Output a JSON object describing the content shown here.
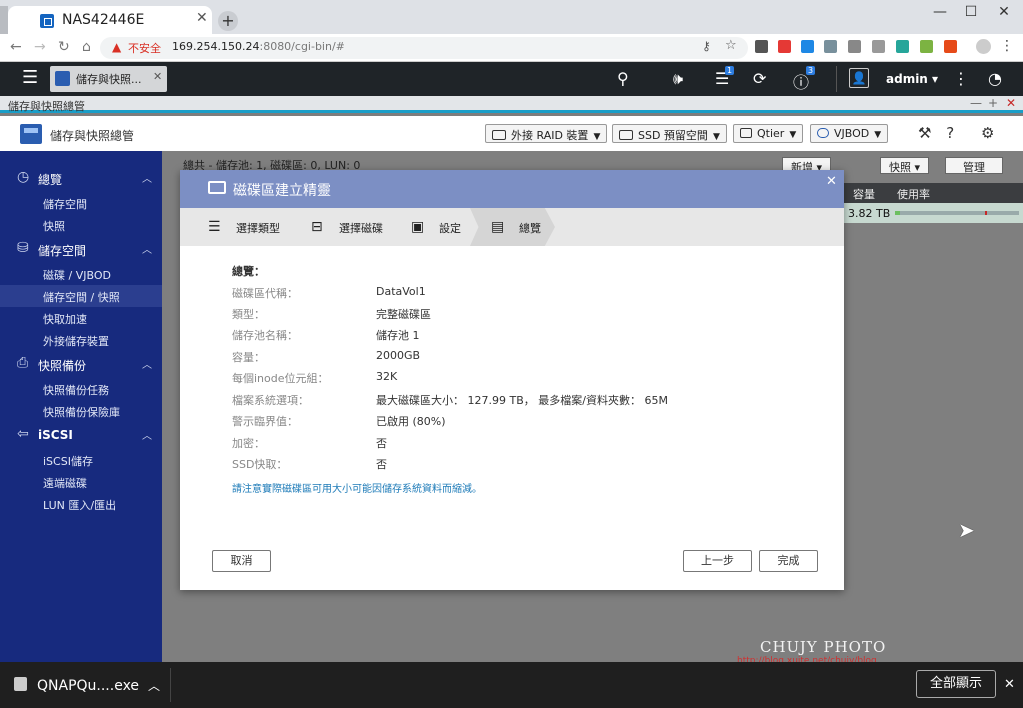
{
  "browser": {
    "tab_title": "NAS42446E",
    "insecure_label": "不安全",
    "url_host": "169.254.150.24",
    "url_rest": ":8080/cgi-bin/#"
  },
  "header": {
    "app_tab_label": "儲存與快照...",
    "notification_count": "1",
    "info_count": "3",
    "username": "admin"
  },
  "window": {
    "title": "儲存與快照總管",
    "app_title": "儲存與快照總管"
  },
  "toolbar": {
    "raid_label": "外接 RAID 裝置",
    "ssd_label": "SSD 預留空間",
    "qtier_label": "Qtier",
    "vjbod_label": "VJBOD"
  },
  "sidebar": {
    "sections": [
      {
        "label": "總覽",
        "items": [
          "儲存空間",
          "快照"
        ]
      },
      {
        "label": "儲存空間",
        "items": [
          "磁碟 / VJBOD",
          "儲存空間 / 快照",
          "快取加速",
          "外接儲存裝置"
        ]
      },
      {
        "label": "快照備份",
        "items": [
          "快照備份任務",
          "快照備份保險庫"
        ]
      },
      {
        "label": "iSCSI",
        "items": [
          "iSCSI儲存",
          "遠端磁碟",
          "LUN 匯入/匯出"
        ]
      }
    ]
  },
  "content": {
    "summary_text": "總共 - 儲存池: 1, 磁碟區: 0, LUN: 0",
    "new_button": "新增",
    "snapshot_button": "快照",
    "manage_button": "管理",
    "col_capacity": "容量",
    "col_usage": "使用率",
    "row_capacity": "3.82 TB",
    "row_usage_fraction": 0.04
  },
  "dialog": {
    "title": "磁碟區建立精靈",
    "steps": [
      "選擇類型",
      "選擇磁碟",
      "設定",
      "總覽"
    ],
    "summary_heading": "總覽：",
    "fields": [
      {
        "label": "磁碟區代稱：",
        "value": "DataVol1"
      },
      {
        "label": "類型：",
        "value": "完整磁碟區"
      },
      {
        "label": "儲存池名稱：",
        "value": "儲存池 1"
      },
      {
        "label": "容量：",
        "value": "2000GB"
      },
      {
        "label": "每個inode位元組：",
        "value": "32K"
      },
      {
        "label": "檔案系統選項：",
        "value": "最大磁碟區大小： 127.99 TB， 最多檔案/資料夾數： 65M"
      },
      {
        "label": "警示臨界值：",
        "value": "已啟用 (80%)"
      },
      {
        "label": "加密：",
        "value": "否"
      },
      {
        "label": "SSD快取：",
        "value": "否"
      }
    ],
    "note": "請注意實際磁碟區可用大小可能因儲存系統資料而縮減。",
    "cancel": "取消",
    "back": "上一步",
    "finish": "完成"
  },
  "watermark": {
    "name": "CHUJY PHOTO",
    "url": "http://blog.xuite.net/chujy/blog"
  },
  "downloads": {
    "file": "QNAPQu....exe",
    "show_all": "全部顯示"
  }
}
